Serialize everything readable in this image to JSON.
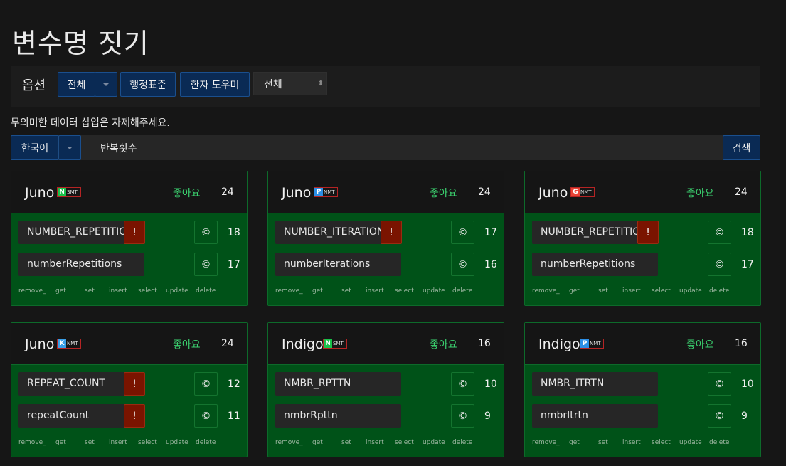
{
  "title": "변수명 짓기",
  "options": {
    "label": "옵션",
    "scope_button": "전체",
    "standard_button": "행정표준",
    "hanja_button": "한자 도우미",
    "select_value": "전체"
  },
  "notice": "무의미한 데이터 삽입은 자제해주세요.",
  "search": {
    "language": "한국어",
    "query": "반복횟수",
    "submit": "검색"
  },
  "actions": [
    "remove_",
    "get",
    "set",
    "insert",
    "select",
    "update",
    "delete"
  ],
  "like_label": "좋아요",
  "copy_glyph": "©",
  "warn_glyph": "!",
  "cards": [
    {
      "name": "Juno",
      "engine_icon": "naver-icon",
      "engine_text": "SMT",
      "engine_color": "#19c14b",
      "engine_glyph": "N",
      "likes": "24",
      "results": [
        {
          "text": "NUMBER_REPETITIO...",
          "warn": true,
          "count": "18"
        },
        {
          "text": "numberRepetitions",
          "warn": false,
          "count": "17"
        }
      ]
    },
    {
      "name": "Juno",
      "engine_icon": "papago-icon",
      "engine_text": "NMT",
      "engine_color": "#2c8fe6",
      "engine_glyph": "P",
      "likes": "24",
      "results": [
        {
          "text": "NUMBER_ITERATIONS",
          "warn": true,
          "count": "17"
        },
        {
          "text": "numberIterations",
          "warn": false,
          "count": "16"
        }
      ]
    },
    {
      "name": "Juno",
      "engine_icon": "google-icon",
      "engine_text": "NMT",
      "engine_color": "#e84335",
      "engine_glyph": "G",
      "likes": "24",
      "results": [
        {
          "text": "NUMBER_REPETITIO...",
          "warn": true,
          "count": "18"
        },
        {
          "text": "numberRepetitions",
          "warn": false,
          "count": "17"
        }
      ]
    },
    {
      "name": "Juno",
      "engine_icon": "kakao-icon",
      "engine_text": "NMT",
      "engine_color": "#3aa0e8",
      "engine_glyph": "K",
      "likes": "24",
      "results": [
        {
          "text": "REPEAT_COUNT",
          "warn": true,
          "count": "12"
        },
        {
          "text": "repeatCount",
          "warn": true,
          "count": "11"
        }
      ]
    },
    {
      "name": "Indigo",
      "engine_icon": "naver-icon",
      "engine_text": "SMT",
      "engine_color": "#19c14b",
      "engine_glyph": "N",
      "likes": "16",
      "results": [
        {
          "text": "NMBR_RPTTN",
          "warn": false,
          "count": "10"
        },
        {
          "text": "nmbrRpttn",
          "warn": false,
          "count": "9"
        }
      ]
    },
    {
      "name": "Indigo",
      "engine_icon": "papago-icon",
      "engine_text": "NMT",
      "engine_color": "#2c8fe6",
      "engine_glyph": "P",
      "likes": "16",
      "results": [
        {
          "text": "NMBR_ITRTN",
          "warn": false,
          "count": "10"
        },
        {
          "text": "nmbrItrtn",
          "warn": false,
          "count": "9"
        }
      ]
    }
  ]
}
